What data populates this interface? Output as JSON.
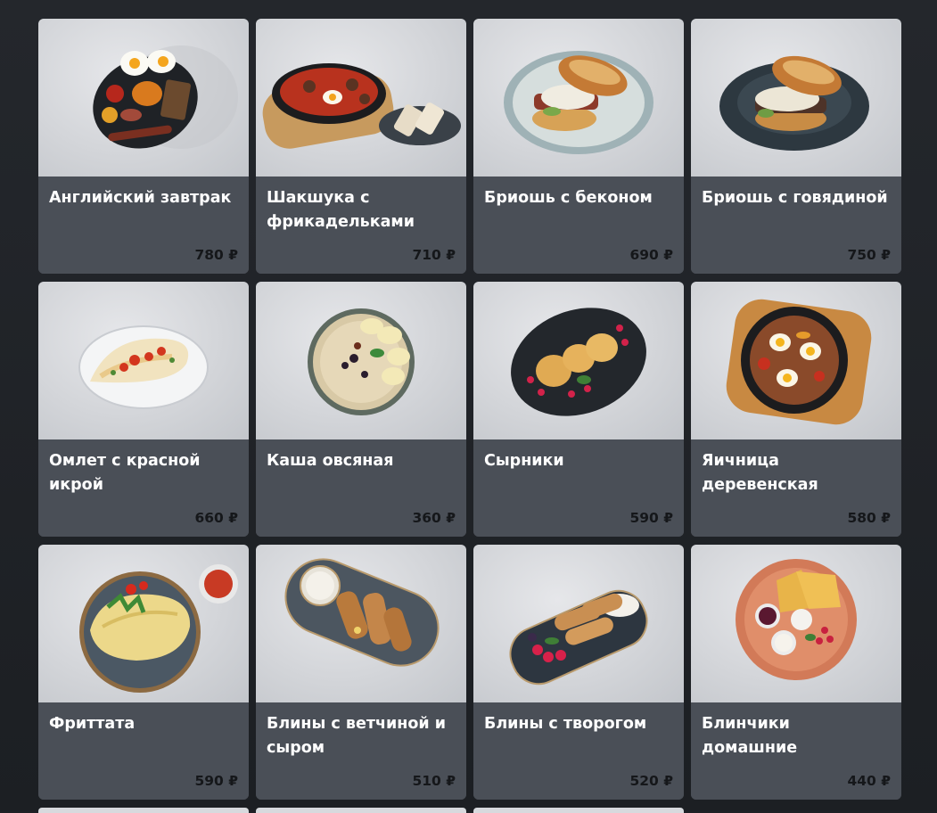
{
  "menu": {
    "items": [
      {
        "name": "Английский завтрак",
        "price": "780 ₽",
        "dish": "english-breakfast"
      },
      {
        "name": "Шакшука с фрикадельками",
        "price": "710 ₽",
        "dish": "shakshuka"
      },
      {
        "name": "Бриошь с беконом",
        "price": "690 ₽",
        "dish": "brioche-bacon"
      },
      {
        "name": "Бриошь с говядиной",
        "price": "750 ₽",
        "dish": "brioche-beef"
      },
      {
        "name": "Омлет с красной икрой",
        "price": "660 ₽",
        "dish": "omelette-caviar"
      },
      {
        "name": "Каша овсяная",
        "price": "360 ₽",
        "dish": "oatmeal"
      },
      {
        "name": "Сырники",
        "price": "590 ₽",
        "dish": "syrniki"
      },
      {
        "name": "Яичница деревенская",
        "price": "580 ₽",
        "dish": "village-eggs"
      },
      {
        "name": "Фриттата",
        "price": "590 ₽",
        "dish": "frittata"
      },
      {
        "name": "Блины с ветчиной и сыром",
        "price": "510 ₽",
        "dish": "pancakes-ham"
      },
      {
        "name": "Блины с творогом",
        "price": "520 ₽",
        "dish": "pancakes-cottage"
      },
      {
        "name": "Блинчики домашние",
        "price": "440 ₽",
        "dish": "homemade-pancakes"
      }
    ]
  },
  "colors": {
    "background": "#1e2126",
    "card_info": "#4a4f57",
    "name_text": "#ffffff",
    "price_text": "#15171a"
  }
}
